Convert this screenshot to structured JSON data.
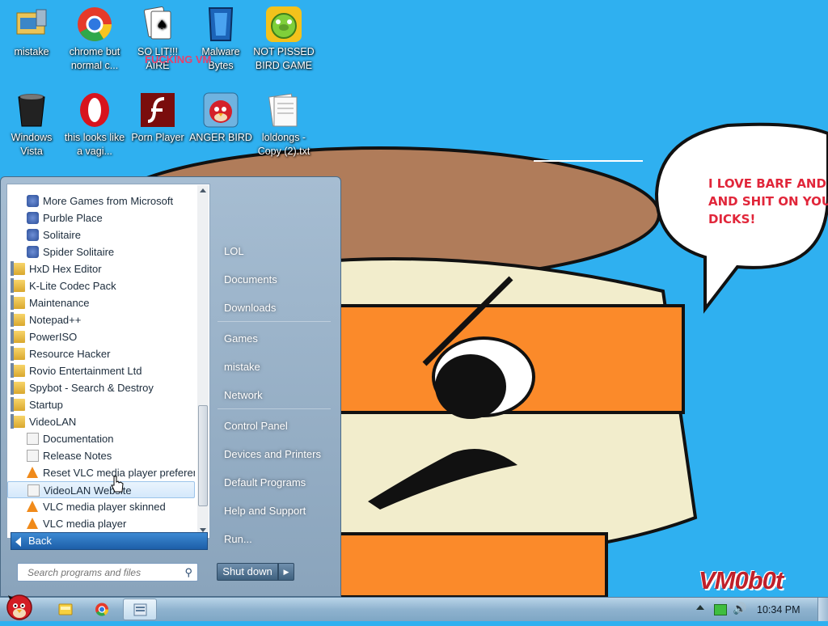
{
  "desktop": {
    "icons": [
      {
        "label": "mistake",
        "icon": "folder-computer-icon"
      },
      {
        "label": "chrome but normal c...",
        "icon": "chrome-icon"
      },
      {
        "label": "SO LIT!!! AIRE",
        "icon": "solitaire-icon"
      },
      {
        "label": "Malware Bytes",
        "icon": "malwarebytes-icon"
      },
      {
        "label": "NOT PISSED BIRD GAME",
        "icon": "bad-piggies-icon"
      },
      {
        "label": "Windows Vista",
        "icon": "recycle-bin-icon"
      },
      {
        "label": "this looks like a vagi...",
        "icon": "opera-icon"
      },
      {
        "label": "Porn Player",
        "icon": "flash-player-icon"
      },
      {
        "label": "ANGER BIRD",
        "icon": "angry-birds-icon"
      },
      {
        "label": "loldongs - Copy (2).txt",
        "icon": "text-file-icon"
      }
    ],
    "overlay_text": "FUCKING VM",
    "speech_bubble": "I LOVE BARF AND PI\nAND SHIT ON YOU\nDICKS!",
    "watermark": "VM0b0t"
  },
  "start_menu": {
    "programs": [
      {
        "label": "More Games from Microsoft",
        "indent": 1,
        "type": "game"
      },
      {
        "label": "Purble Place",
        "indent": 1,
        "type": "game"
      },
      {
        "label": "Solitaire",
        "indent": 1,
        "type": "game"
      },
      {
        "label": "Spider Solitaire",
        "indent": 1,
        "type": "game"
      },
      {
        "label": "HxD Hex Editor",
        "indent": 0,
        "type": "folder"
      },
      {
        "label": "K-Lite Codec Pack",
        "indent": 0,
        "type": "folder"
      },
      {
        "label": "Maintenance",
        "indent": 0,
        "type": "folder"
      },
      {
        "label": "Notepad++",
        "indent": 0,
        "type": "folder"
      },
      {
        "label": "PowerISO",
        "indent": 0,
        "type": "folder"
      },
      {
        "label": "Resource Hacker",
        "indent": 0,
        "type": "folder"
      },
      {
        "label": "Rovio Entertainment Ltd",
        "indent": 0,
        "type": "folder"
      },
      {
        "label": "Spybot - Search & Destroy",
        "indent": 0,
        "type": "folder"
      },
      {
        "label": "Startup",
        "indent": 0,
        "type": "folder"
      },
      {
        "label": "VideoLAN",
        "indent": 0,
        "type": "folder"
      },
      {
        "label": "Documentation",
        "indent": 1,
        "type": "doc"
      },
      {
        "label": "Release Notes",
        "indent": 1,
        "type": "doc"
      },
      {
        "label": "Reset VLC media player preferences",
        "indent": 1,
        "type": "vlc"
      },
      {
        "label": "VideoLAN Website",
        "indent": 1,
        "type": "doc",
        "selected": true
      },
      {
        "label": "VLC media player skinned",
        "indent": 1,
        "type": "vlc"
      },
      {
        "label": "VLC media player",
        "indent": 1,
        "type": "vlc"
      }
    ],
    "back_label": "Back",
    "search_placeholder": "Search programs and files",
    "right_items": [
      "LOL",
      "Documents",
      "Downloads",
      "Games",
      "mistake",
      "Network",
      "Control Panel",
      "Devices and Printers",
      "Default Programs",
      "Help and Support",
      "Run..."
    ],
    "shutdown_label": "Shut down"
  },
  "taskbar": {
    "clock": "10:34 PM",
    "items": [
      "start-orb-icon",
      "explorer-icon",
      "chrome-icon",
      "program-icon"
    ]
  },
  "colors": {
    "desktop_bg": "#2fb0f0",
    "speech_text": "#e1263a"
  }
}
